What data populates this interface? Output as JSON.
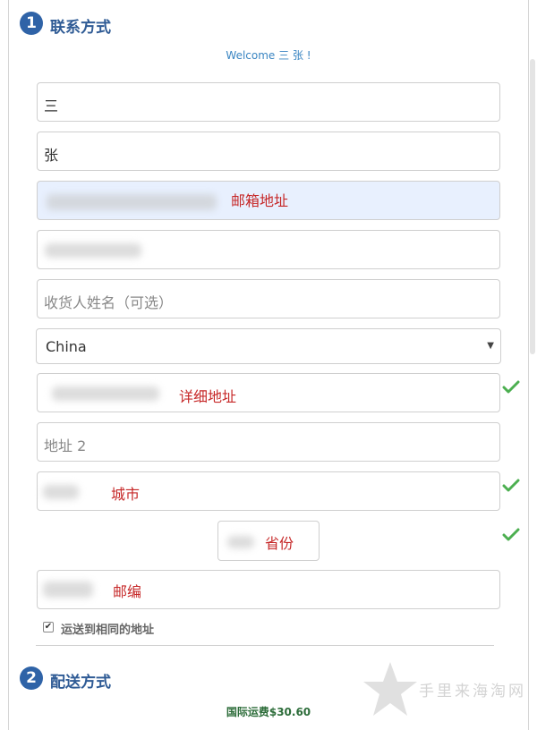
{
  "contact": {
    "step_number": "1",
    "title": "联系方式",
    "welcome": "Welcome 三 张 !",
    "first_name": "三",
    "last_name": "张",
    "email_note": "邮箱地址",
    "recipient_placeholder": "收货人姓名（可选）",
    "country": "China",
    "address_note": "详细地址",
    "address2_placeholder": "地址 2",
    "city_note": "城市",
    "province_note": "省份",
    "zip_note": "邮编",
    "same_address_label": "运送到相同的地址"
  },
  "shipping": {
    "step_number": "2",
    "title": "配送方式",
    "price_label": "国际运费$30.60"
  },
  "watermark": {
    "text": "手里来海淘网"
  },
  "colors": {
    "step_badge": "#2f63a7",
    "step_title": "#2f5b95",
    "welcome": "#3a85c2",
    "note_red": "#c62828",
    "check_green": "#4caf50",
    "price_green": "#2d6d3a",
    "autofill_blue": "#e8f0fe"
  },
  "icons": {
    "valid_check": "checkmark-icon",
    "country_caret": "triangle-down-icon",
    "watermark_star": "star-icon"
  }
}
